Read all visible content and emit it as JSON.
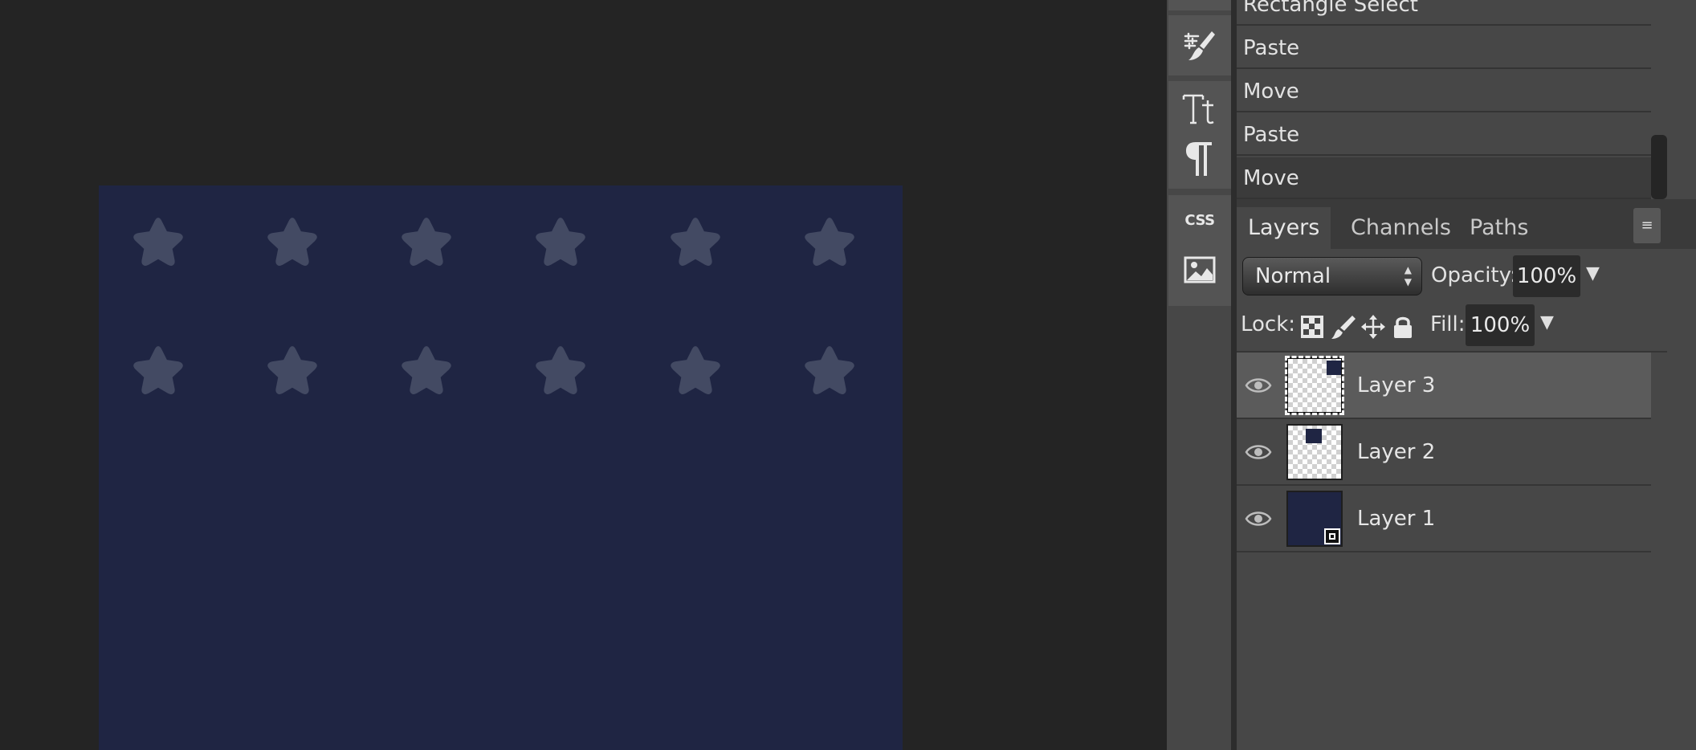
{
  "history": {
    "items": [
      {
        "label": "Rectangle Select"
      },
      {
        "label": "Paste"
      },
      {
        "label": "Move"
      },
      {
        "label": "Paste"
      },
      {
        "label": "Move"
      }
    ]
  },
  "tools": {
    "icons": [
      "brush-settings-icon",
      "text-icon",
      "paragraph-icon",
      "css-icon",
      "image-icon"
    ],
    "css_label": "CSS"
  },
  "panel": {
    "tabs": [
      {
        "label": "Layers",
        "active": true
      },
      {
        "label": "Channels",
        "active": false
      },
      {
        "label": "Paths",
        "active": false
      }
    ],
    "menu_icon": "hamburger-icon"
  },
  "layer_controls": {
    "blend_mode": "Normal",
    "opacity_label": "Opacity:",
    "opacity_value": "100%",
    "lock_label": "Lock:",
    "lock_icons": [
      "lock-transparency-icon",
      "lock-paint-icon",
      "lock-position-icon",
      "lock-all-icon"
    ],
    "fill_label": "Fill:",
    "fill_value": "100%"
  },
  "layers": [
    {
      "name": "Layer 3",
      "visible": true,
      "selected": true
    },
    {
      "name": "Layer 2",
      "visible": true,
      "selected": false
    },
    {
      "name": "Layer 1",
      "visible": true,
      "selected": false
    }
  ],
  "canvas": {
    "background_color": "#1f2543",
    "star_color": "#434a63",
    "star_rows": 2,
    "star_columns": 6
  }
}
